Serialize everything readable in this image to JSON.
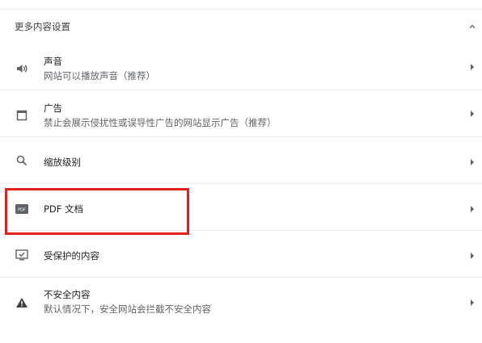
{
  "section": {
    "title": "更多内容设置",
    "expanded": true
  },
  "items": [
    {
      "id": "sound",
      "icon": "speaker-icon",
      "title": "声音",
      "subtitle": "网站可以播放声音（推荐）"
    },
    {
      "id": "ads",
      "icon": "ads-window-icon",
      "title": "广告",
      "subtitle": "禁止会展示侵扰性或误导性广告的网站显示广告（推荐）"
    },
    {
      "id": "zoom",
      "icon": "search-icon",
      "title": "缩放级别",
      "subtitle": ""
    },
    {
      "id": "pdf",
      "icon": "pdf-document-icon",
      "title": "PDF 文档",
      "subtitle": "",
      "pdf_badge": "PDF"
    },
    {
      "id": "protected",
      "icon": "protected-content-icon",
      "title": "受保护的内容",
      "subtitle": ""
    },
    {
      "id": "insecure",
      "icon": "warning-icon",
      "title": "不安全内容",
      "subtitle": "默认情况下，安全网站会拦截不安全内容"
    }
  ],
  "colors": {
    "highlight": "#e0201b",
    "icon": "#5f6368",
    "divider": "#e8eaed"
  }
}
